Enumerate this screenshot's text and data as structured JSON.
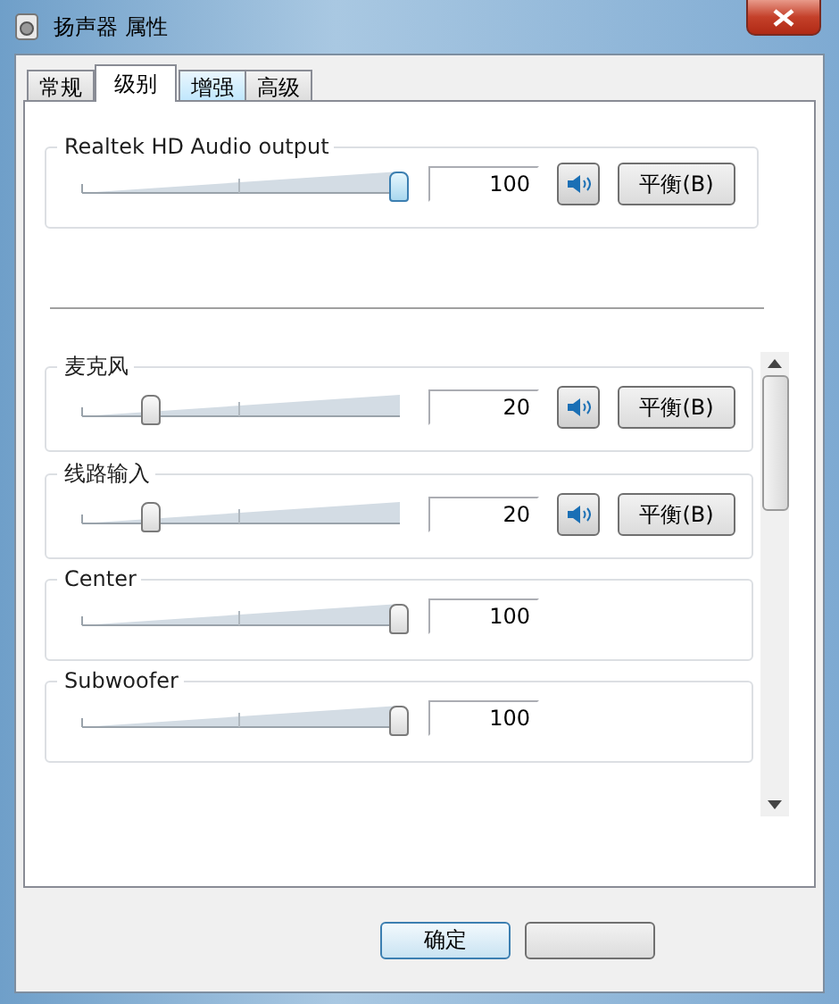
{
  "window": {
    "title": "扬声器 属性"
  },
  "tabs": [
    {
      "label": "常规",
      "selected": false,
      "hovered": false
    },
    {
      "label": "级别",
      "selected": true,
      "hovered": false
    },
    {
      "label": "增强",
      "selected": false,
      "hovered": true
    },
    {
      "label": "高级",
      "selected": false,
      "hovered": false
    }
  ],
  "master": {
    "name": "Realtek HD Audio output",
    "level": 1,
    "value": "100",
    "muted": false,
    "balance_button": "平衡(B)"
  },
  "channels": [
    {
      "kind": "full",
      "name": "麦克风",
      "level": 0.2,
      "value": "20",
      "muted": false,
      "balance_button": "平衡(B)"
    },
    {
      "kind": "full",
      "name": "线路输入",
      "level": 0.2,
      "value": "20",
      "muted": false,
      "balance_button": "平衡(B)"
    },
    {
      "kind": "plain",
      "name": "Center",
      "level": 1,
      "value": "100"
    },
    {
      "kind": "plain",
      "name": "Subwoofer",
      "level": 1,
      "value": "100"
    }
  ],
  "buttons": [
    "确定"
  ]
}
